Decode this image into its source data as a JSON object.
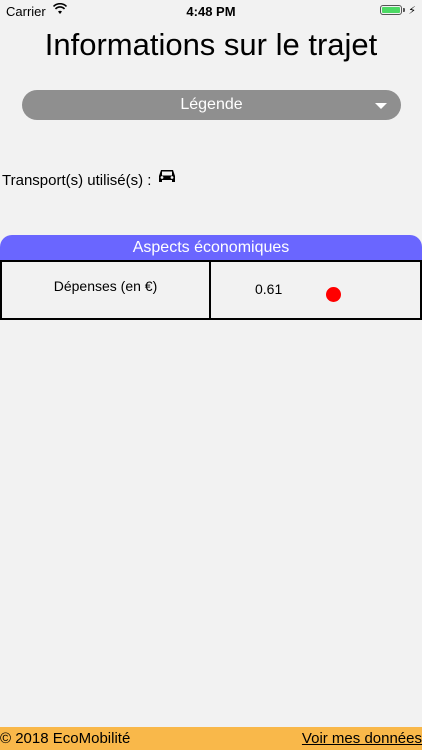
{
  "status_bar": {
    "carrier": "Carrier",
    "time": "4:48 PM",
    "icons": [
      "wifi-icon",
      "battery-icon",
      "charging-icon"
    ]
  },
  "title": "Informations sur le trajet",
  "legend_dropdown": {
    "label": "Légende"
  },
  "transport": {
    "label": "Transport(s) utilisé(s) :",
    "icon": "car-icon"
  },
  "economic": {
    "header": "Aspects économiques",
    "rows": [
      {
        "label": "Dépenses (en €)",
        "value": "0.61",
        "status_color": "#ff0000"
      }
    ]
  },
  "footer": {
    "copyright": "© 2018 EcoMobilité",
    "link": "Voir mes données"
  },
  "colors": {
    "background": "#f2f2f2",
    "dropdown": "#8f8f8f",
    "header": "#6a66ff",
    "footer": "#f9b84a"
  }
}
